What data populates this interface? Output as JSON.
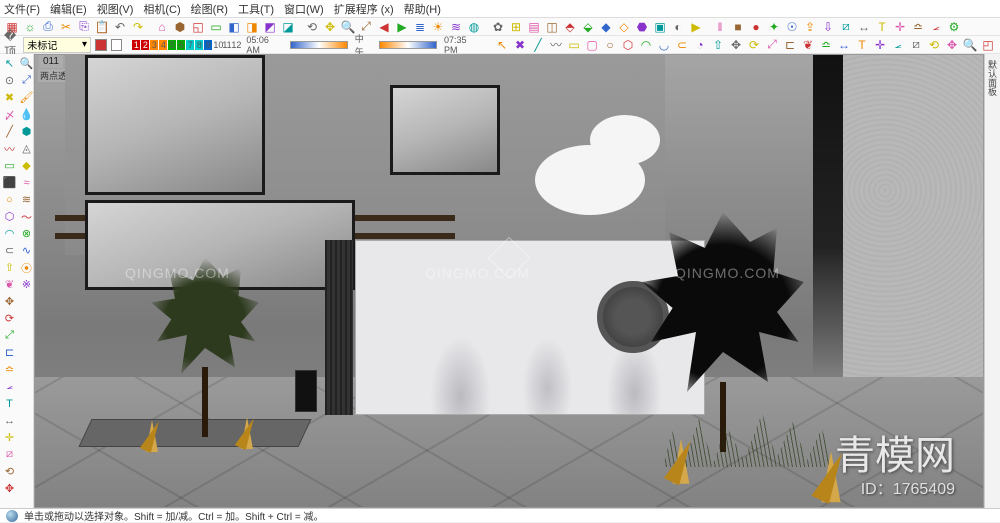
{
  "menu": {
    "file": "文件(F)",
    "edit": "编辑(E)",
    "view": "视图(V)",
    "camera": "相机(C)",
    "draw": "绘图(R)",
    "tools": "工具(T)",
    "window": "窗口(W)",
    "extensions": "扩展程序 (x)",
    "help": "帮助(H)"
  },
  "layer": {
    "current": "未标记",
    "dropdown_glyph": "▾"
  },
  "timeline": {
    "nums": [
      "1",
      "2",
      "3",
      "4",
      "5",
      "6",
      "7",
      "8",
      "9",
      "10",
      "11",
      "12"
    ],
    "time_am": "05:06 AM",
    "noon": "中午",
    "time_pm": "07:35 PM"
  },
  "toolbar1": [
    "new-file",
    "open",
    "save",
    "cut",
    "copy",
    "paste",
    "undo",
    "redo",
    "print",
    "model-info",
    "iso",
    "top",
    "front",
    "right",
    "back",
    "left",
    "orbit",
    "pan",
    "zoom",
    "zoom-ext",
    "prev",
    "next",
    "layers",
    "shadow",
    "fog",
    "xray",
    "styles",
    "outliner",
    "scenes",
    "components",
    "materials",
    "3dwh",
    "ext",
    "ruby",
    "geo",
    "img",
    "anim",
    "play",
    "pause",
    "stop",
    "rec",
    "cam",
    "sun",
    "export",
    "import",
    "section",
    "dim",
    "text",
    "axes",
    "tape",
    "protractor",
    "settings"
  ],
  "toolbar1_glyphs": [
    "▦",
    "☼",
    "⎙",
    "✂",
    "⎘",
    "📋",
    "↶",
    "↷",
    "⌂",
    "⬢",
    "◱",
    "▭",
    "◧",
    "◨",
    "◩",
    "◪",
    "⟲",
    "✥",
    "🔍",
    "⤢",
    "◀",
    "▶",
    "≣",
    "☀",
    "≋",
    "◍",
    "✿",
    "⊞",
    "▤",
    "◫",
    "⬘",
    "⬙",
    "◆",
    "◇",
    "⬣",
    "▣",
    "◐",
    "▶",
    "‖",
    "■",
    "●",
    "✦",
    "☉",
    "⇪",
    "⇩",
    "⧄",
    "↔",
    "T",
    "✛",
    "≏",
    "⦟",
    "⚙"
  ],
  "toolbar2": [
    "select",
    "eraser",
    "line",
    "freehand",
    "rect",
    "rrect",
    "circle",
    "poly",
    "arc",
    "2arc",
    "3arc",
    "pie",
    "pushpull",
    "move",
    "rotate",
    "scale",
    "offset",
    "followme",
    "tape2",
    "dim2",
    "text2",
    "axes2",
    "protractor2",
    "section2",
    "orbit2",
    "pan2",
    "zoom2",
    "zoom-win",
    "zoom-ext2",
    "prev2",
    "position",
    "walk",
    "look",
    "sandbox1",
    "sandbox2",
    "sandbox3",
    "solid1",
    "solid2",
    "solid3",
    "solid4",
    "solid5",
    "paint",
    "sample",
    "component",
    "group",
    "explode",
    "hide",
    "unhide",
    "lock",
    "soften",
    "pref"
  ],
  "toolbar2_glyphs": [
    "↖",
    "✖",
    "╱",
    "〰",
    "▭",
    "▢",
    "○",
    "⬡",
    "◠",
    "◡",
    "⊂",
    "◔",
    "⇧",
    "✥",
    "⟳",
    "⤢",
    "⊏",
    "❦",
    "≏",
    "↔",
    "T",
    "✛",
    "⦟",
    "⧄",
    "⟲",
    "✥",
    "🔍",
    "◰",
    "⤢",
    "◀",
    "☉",
    "🚶",
    "👁",
    "◬",
    "△",
    "▽",
    "⬢",
    "⬡",
    "◆",
    "◇",
    "◈",
    "🖌",
    "💧",
    "⬘",
    "⊞",
    "✧",
    "⊘",
    "⊙",
    " ",
    "~",
    "⚙"
  ],
  "left_tools": [
    "select",
    "lasso",
    "eraser",
    "eraser2",
    "line",
    "freehand",
    "rect",
    "rect2",
    "circle",
    "poly",
    "arc",
    "arc2",
    "pushpull",
    "followme",
    "move",
    "rotate",
    "scale",
    "offset",
    "tape",
    "protractor",
    "text",
    "dim",
    "axes",
    "section",
    "orbit",
    "pan",
    "zoom",
    "zoom-ext",
    "paint",
    "sample",
    "3dwh",
    "sandbox",
    "solid",
    "plugin1",
    "plugin2",
    "plugin3",
    "plugin4",
    "plugin5",
    "plugin6",
    "plugin7"
  ],
  "left_glyphs": [
    "↖",
    "⊙",
    "✖",
    "〆",
    "╱",
    "〰",
    "▭",
    "⬛",
    "○",
    "⬡",
    "◠",
    "⊂",
    "⇧",
    "❦",
    "✥",
    "⟳",
    "⤢",
    "⊏",
    "≏",
    "⦟",
    "T",
    "↔",
    "✛",
    "⧄",
    "⟲",
    "✥",
    "🔍",
    "⤢",
    "🖌",
    "💧",
    "⬢",
    "◬",
    "◆",
    "≈",
    "≋",
    "〜",
    "⊗",
    "∿",
    "⦿",
    "※"
  ],
  "scene": {
    "tab": "011",
    "label": "两点透视"
  },
  "right_panel": "默认面板",
  "watermark": "QINGMO.COM",
  "brand": "青模网",
  "id_label": "ID：1765409",
  "status": {
    "hint": "单击或拖动以选择对象。Shift = 加/减。Ctrl = 加。Shift + Ctrl = 减。"
  }
}
